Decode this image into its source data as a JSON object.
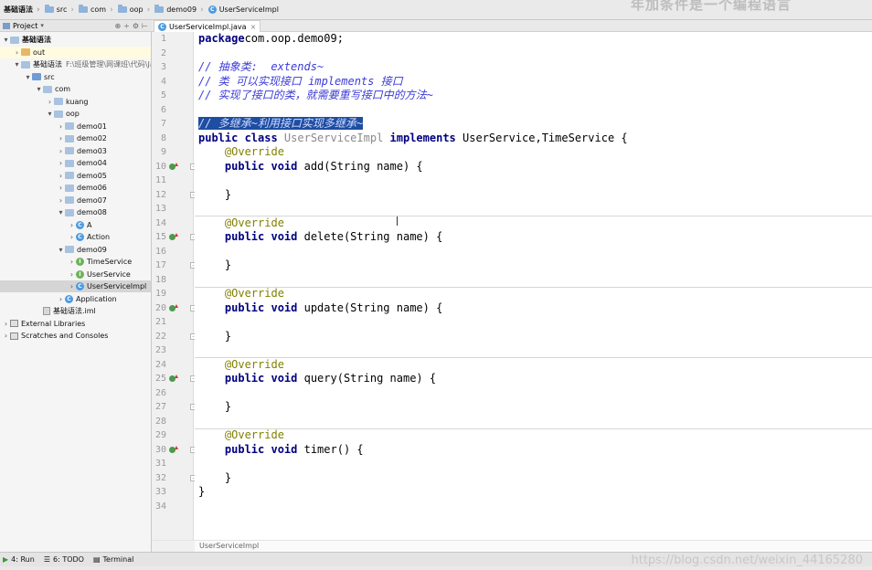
{
  "navbar": {
    "crumbs": [
      "基础语法",
      "src",
      "com",
      "oop",
      "demo09",
      "UserServiceImpl"
    ],
    "banner": "年加条件是一个编程语言"
  },
  "project_panel": {
    "title": "Project",
    "dropdown": "▾",
    "tools": [
      "⊕",
      "÷",
      "⚙",
      "⊢"
    ]
  },
  "editor_tab": {
    "label": "UserServiceImpl.java",
    "close": "×"
  },
  "tree": [
    {
      "label": "基础语法",
      "arrow": "▾",
      "kind": "module",
      "bold": true
    },
    {
      "label": "out",
      "arrow": "›",
      "kind": "orange"
    },
    {
      "label": "基础语法",
      "arrow": "▾",
      "kind": "module",
      "path": "F:\\班级管理\\网课班\\代码\\Ja"
    },
    {
      "label": "src",
      "arrow": "▾",
      "kind": "blue"
    },
    {
      "label": "com",
      "arrow": "▾",
      "kind": "folder"
    },
    {
      "label": "kuang",
      "arrow": "›",
      "kind": "folder"
    },
    {
      "label": "oop",
      "arrow": "▾",
      "kind": "folder"
    },
    {
      "label": "demo01",
      "arrow": "›",
      "kind": "folder"
    },
    {
      "label": "demo02",
      "arrow": "›",
      "kind": "folder"
    },
    {
      "label": "demo03",
      "arrow": "›",
      "kind": "folder"
    },
    {
      "label": "demo04",
      "arrow": "›",
      "kind": "folder"
    },
    {
      "label": "demo05",
      "arrow": "›",
      "kind": "folder"
    },
    {
      "label": "demo06",
      "arrow": "›",
      "kind": "folder"
    },
    {
      "label": "demo07",
      "arrow": "›",
      "kind": "folder"
    },
    {
      "label": "demo08",
      "arrow": "▾",
      "kind": "folder"
    },
    {
      "label": "A",
      "arrow": "›",
      "kind": "class",
      "icon": "C"
    },
    {
      "label": "Action",
      "arrow": "›",
      "kind": "class",
      "icon": "C"
    },
    {
      "label": "demo09",
      "arrow": "▾",
      "kind": "folder"
    },
    {
      "label": "TimeService",
      "arrow": "›",
      "kind": "interface",
      "icon": "I"
    },
    {
      "label": "UserService",
      "arrow": "›",
      "kind": "interface",
      "icon": "I"
    },
    {
      "label": "UserServiceImpl",
      "arrow": "›",
      "kind": "class",
      "icon": "C",
      "selected": true
    },
    {
      "label": "Application",
      "arrow": "›",
      "kind": "class",
      "icon": "C"
    },
    {
      "label": "基础语法.iml",
      "arrow": "",
      "kind": "file"
    },
    {
      "label": "External Libraries",
      "arrow": "›",
      "kind": "lib"
    },
    {
      "label": "Scratches and Consoles",
      "arrow": "›",
      "kind": "lib"
    }
  ],
  "code": {
    "line_numbers": [
      "1",
      "2",
      "3",
      "4",
      "5",
      "6",
      "7",
      "8",
      "9",
      "10",
      "11",
      "12",
      "13",
      "14",
      "15",
      "16",
      "17",
      "18",
      "19",
      "20",
      "21",
      "22",
      "23",
      "24",
      "25",
      "26",
      "27",
      "28",
      "29",
      "30",
      "31",
      "32",
      "33",
      "34"
    ],
    "lines": [
      [
        [
          "kw",
          "package"
        ],
        [
          "",
          "com.oop.demo09;"
        ]
      ],
      [],
      [
        [
          "cm",
          "// 抽象类:  extends~"
        ]
      ],
      [
        [
          "cm",
          "// 类 可以实现接口 implements 接口"
        ]
      ],
      [
        [
          "cm",
          "// 实现了接口的类，就需要重写接口中的方法~"
        ]
      ],
      [],
      [
        [
          "sel",
          "// 多继承~利用接口实现多继承~"
        ]
      ],
      [
        [
          "kw",
          "public class "
        ],
        [
          "gr",
          "UserServiceImpl "
        ],
        [
          "kw",
          "implements "
        ],
        [
          "",
          "UserService,TimeService {"
        ]
      ],
      [
        [
          "",
          "    "
        ],
        [
          "an",
          "@Override"
        ]
      ],
      [
        [
          "",
          "    "
        ],
        [
          "kw",
          "public void "
        ],
        [
          "",
          "add(String name) {"
        ]
      ],
      [],
      [
        [
          "",
          "    }"
        ]
      ],
      [],
      [
        [
          "",
          "    "
        ],
        [
          "an",
          "@Override"
        ]
      ],
      [
        [
          "",
          "    "
        ],
        [
          "kw",
          "public void "
        ],
        [
          "",
          "delete(String name) {"
        ]
      ],
      [],
      [
        [
          "",
          "    }"
        ]
      ],
      [],
      [
        [
          "",
          "    "
        ],
        [
          "an",
          "@Override"
        ]
      ],
      [
        [
          "",
          "    "
        ],
        [
          "kw",
          "public void "
        ],
        [
          "",
          "update(String name) {"
        ]
      ],
      [],
      [
        [
          "",
          "    }"
        ]
      ],
      [],
      [
        [
          "",
          "    "
        ],
        [
          "an",
          "@Override"
        ]
      ],
      [
        [
          "",
          "    "
        ],
        [
          "kw",
          "public void "
        ],
        [
          "",
          "query(String name) {"
        ]
      ],
      [],
      [
        [
          "",
          "    }"
        ]
      ],
      [],
      [
        [
          "",
          "    "
        ],
        [
          "an",
          "@Override"
        ]
      ],
      [
        [
          "",
          "    "
        ],
        [
          "kw",
          "public void "
        ],
        [
          "",
          "timer() {"
        ]
      ],
      [],
      [
        [
          "",
          "    }"
        ]
      ],
      [
        [
          "",
          "}"
        ]
      ],
      []
    ],
    "implementing_lines": [
      10,
      15,
      20,
      25,
      30
    ],
    "fold_lines": [
      10,
      12,
      15,
      17,
      20,
      22,
      25,
      27,
      30,
      32
    ],
    "separator_after": [
      13,
      18,
      23,
      28
    ]
  },
  "editor_breadcrumb": "UserServiceImpl",
  "bottom_tools": [
    {
      "icon": "▶",
      "label": "4: Run"
    },
    {
      "icon": "☰",
      "label": "6: TODO"
    },
    {
      "icon": "▤",
      "label": "Terminal"
    }
  ],
  "watermark": "https://blog.csdn.net/weixin_44165280",
  "colors": {
    "keyword": "#000080",
    "annotation": "#808000",
    "comment": "#3b3bd9",
    "selection": "#1e4ea1",
    "class_icon": "#4b9be3",
    "interface_icon": "#6fb35a"
  }
}
